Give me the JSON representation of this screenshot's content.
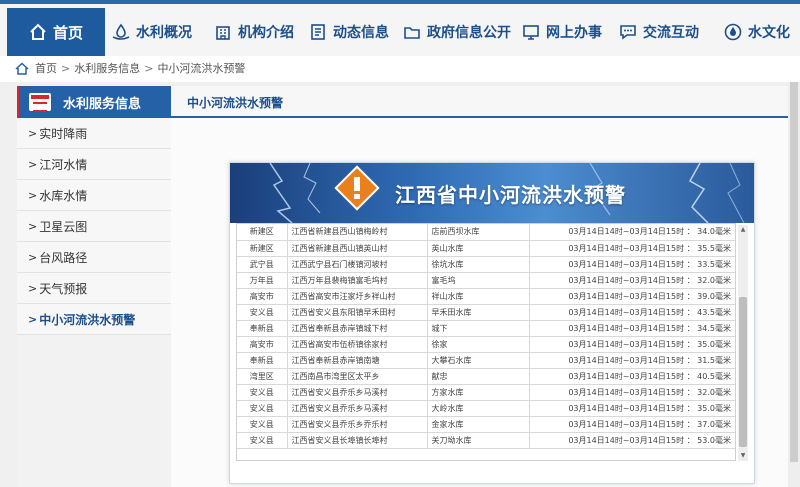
{
  "nav": {
    "home": "首页",
    "items": [
      "水利概况",
      "机构介绍",
      "动态信息",
      "政府信息公开",
      "网上办事",
      "交流互动",
      "水文化"
    ]
  },
  "breadcrumb": [
    "首页",
    "水利服务信息",
    "中小河流洪水预警"
  ],
  "sidebar": {
    "title": "水利服务信息",
    "items": [
      "实时降雨",
      "江河水情",
      "水库水情",
      "卫星云图",
      "台风路径",
      "天气预报",
      "中小河流洪水预警"
    ],
    "active_index": 6
  },
  "main": {
    "title": "中小河流洪水预警"
  },
  "panel": {
    "banner_title": "江西省中小河流洪水预警",
    "rows": [
      [
        "新建区",
        "江西省新建县西山镇梅岭村",
        "店前西坝水库",
        "03月14日14时~03月14日15时 ： 34.0毫米"
      ],
      [
        "新建区",
        "江西省新建县西山镇英山村",
        "英山水库",
        "03月14日14时~03月14日15时 ： 35.5毫米"
      ],
      [
        "武宁县",
        "江西武宁县石门楼镇河坡村",
        "徐坑水库",
        "03月14日14时~03月14日15时 ： 33.5毫米"
      ],
      [
        "万年县",
        "江西万年县裴梅镇富毛坞村",
        "富毛坞",
        "03月14日14时~03月14日15时 ： 32.0毫米"
      ],
      [
        "高安市",
        "江西省高安市汪家圩乡祥山村",
        "祥山水库",
        "03月14日14时~03月14日15时 ： 39.0毫米"
      ],
      [
        "安义县",
        "江西省安义县东阳镇早禾田村",
        "早禾田水库",
        "03月14日14时~03月14日15时 ： 43.5毫米"
      ],
      [
        "奉新县",
        "江西省奉新县赤岸镇城下村",
        "城下",
        "03月14日14时~03月14日15时 ： 34.5毫米"
      ],
      [
        "高安市",
        "江西省高安市伍桥镇徐家村",
        "徐家",
        "03月14日14时~03月14日15时 ： 35.0毫米"
      ],
      [
        "奉新县",
        "江西省奉新县赤岸镇南塘",
        "大攀石水库",
        "03月14日14时~03月14日15时 ： 31.5毫米"
      ],
      [
        "湾里区",
        "江西南昌市湾里区太平乡",
        "献忠",
        "03月14日14时~03月14日15时 ： 40.5毫米"
      ],
      [
        "安义县",
        "江西省安义县乔乐乡马溪村",
        "方家水库",
        "03月14日14时~03月14日15时 ： 32.0毫米"
      ],
      [
        "安义县",
        "江西省安义县乔乐乡马溪村",
        "大岭水库",
        "03月14日14时~03月14日15时 ： 35.0毫米"
      ],
      [
        "安义县",
        "江西省安义县乔乐乡乔乐村",
        "金家水库",
        "03月14日14时~03月14日15时 ： 37.0毫米"
      ],
      [
        "安义县",
        "江西省安义县长埠镇长埠村",
        "关刀坳水库",
        "03月14日14时~03月14日15时 ： 53.0毫米"
      ]
    ]
  },
  "colors": {
    "brand_blue": "#1d5a9e",
    "accent_red": "#d9262c",
    "warning_orange": "#e8811c"
  }
}
